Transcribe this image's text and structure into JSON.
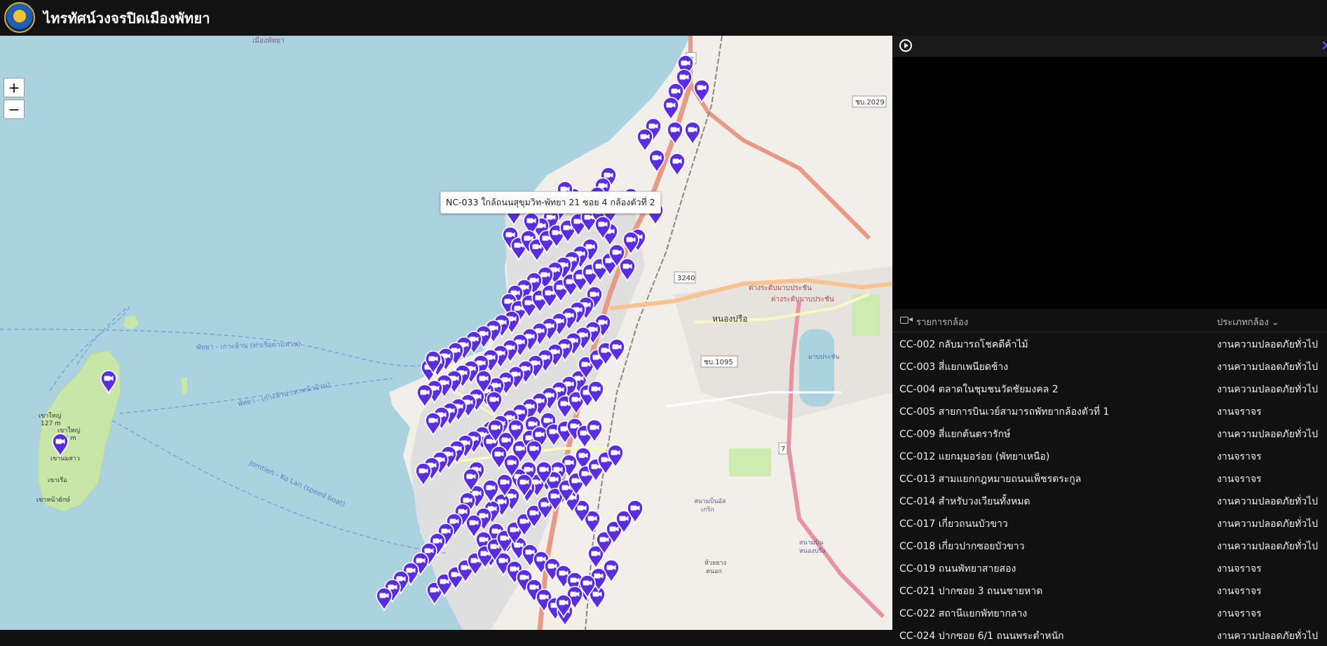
{
  "app": {
    "title": "ไทรทัศน์วงจรปิดเมืองพัทยา",
    "accent_color": "#5b2de0"
  },
  "map": {
    "zoom_in_label": "+",
    "zoom_out_label": "−",
    "tooltip": "NC-033 ใกล้ถนนสุขุมวิท-พัทยา 21 ซอย 4 กล้องตัวที่ 2",
    "labels": {
      "muang": "เมืองพัทยา",
      "route3": "3",
      "chonburi2029": "ชบ.2029",
      "route3240": "3240",
      "nongprue": "หนองปรือ",
      "chonburi1095": "ชบ.1095",
      "route7": "7",
      "ferry1": "พัทยา - เกาะล้าน (ท่าเรือตาแหวน)",
      "ferry2": "พัทยา - เกาะล้าน (ท่าหน้าบ้าน)",
      "speedboat": "Jomtien - Ko Lan (speed boat)",
      "mtn1": "เขาใหญ่",
      "mtn1b": "127 m",
      "mtn2": "เขาใหญ่",
      "mtn2b": "188 m",
      "mtn3": "เขานมสาว",
      "mtn4": "เขาเรือ",
      "mtn5": "เขาหน้ายักษ์",
      "airport1": "สนามบินอัส",
      "airport1b": "เกริก",
      "airport2": "สนามบิน",
      "airport2b": "หนองปรือ",
      "interchange1": "ต่างระดับมาบประชัน",
      "interchange2": "ต่างระดับมาบประชัน",
      "reservoir": "มาบประชัน",
      "huaiyai": "ห้วยยาง",
      "tambon": "ตนอก"
    }
  },
  "panel": {
    "list_title": "รายการกล้อง",
    "type_title": "ประเภทกล้อง ⌄",
    "close": "✕",
    "cameras": [
      {
        "name": "CC-002 กลับมารถโชคดีค้าไม้",
        "type": "งานความปลอดภัยทั่วไป"
      },
      {
        "name": "CC-003 สี่แยกเพนียดช้าง",
        "type": "งานความปลอดภัยทั่วไป"
      },
      {
        "name": "CC-004 ตลาดในชุมชนวัดชัยมงคล 2",
        "type": "งานความปลอดภัยทั่วไป"
      },
      {
        "name": "CC-005 สายการบินเวย์สามารถพัทยากล้องตัวที่ 1",
        "type": "งานจราจร"
      },
      {
        "name": "CC-009 สี่แยกต้นตรารักษ์",
        "type": "งานความปลอดภัยทั่วไป"
      },
      {
        "name": "CC-012 แยกมุมอร่อย (พัทยาเหนือ)",
        "type": "งานจราจร"
      },
      {
        "name": "CC-013 สามแยกกฎหมายถนนเพ็ชรตระกูล",
        "type": "งานจราจร"
      },
      {
        "name": "CC-014 สำหรับวงเวียนทั้งหมด",
        "type": "งานความปลอดภัยทั่วไป"
      },
      {
        "name": "CC-017 เกี่ยวถนนบัวขาว",
        "type": "งานความปลอดภัยทั่วไป"
      },
      {
        "name": "CC-018 เกี่ยวปากซอยบัวขาว",
        "type": "งานความปลอดภัยทั่วไป"
      },
      {
        "name": "CC-019 ถนนพัทยาสายสอง",
        "type": "งานจราจร"
      },
      {
        "name": "CC-021 ปากซอย 3 ถนนชายหาด",
        "type": "งานจราจร"
      },
      {
        "name": "CC-022 สถานีแยกพัทยากลาง",
        "type": "งานจราจร"
      },
      {
        "name": "CC-024 ปากซอย 6/1 ถนนพระตำหนัก",
        "type": "งานความปลอดภัยทั่วไป"
      }
    ]
  }
}
